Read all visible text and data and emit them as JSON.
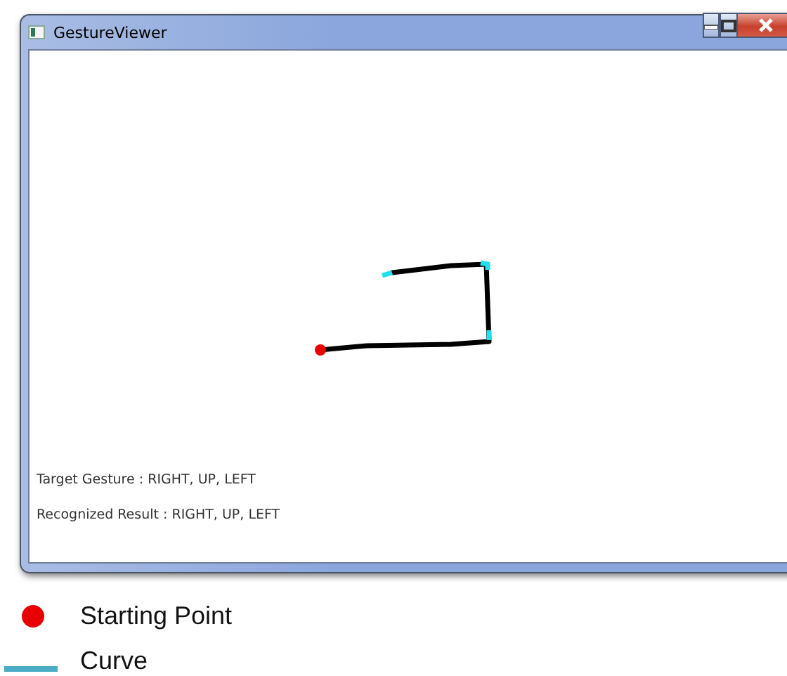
{
  "window": {
    "title": "GestureViewer",
    "controls": [
      {
        "kind": "minimize"
      },
      {
        "kind": "maximize"
      },
      {
        "kind": "close"
      }
    ]
  },
  "canvas": {
    "target_gesture": "Target Gesture : RIGHT, UP, LEFT",
    "recognized_result": "Recognized Result : RIGHT, UP, LEFT"
  },
  "legend": [
    {
      "kind": "dot",
      "label": "Starting Point",
      "color": "#e80000"
    },
    {
      "kind": "line",
      "label": "Curve",
      "color": "#4bacc6"
    }
  ]
}
